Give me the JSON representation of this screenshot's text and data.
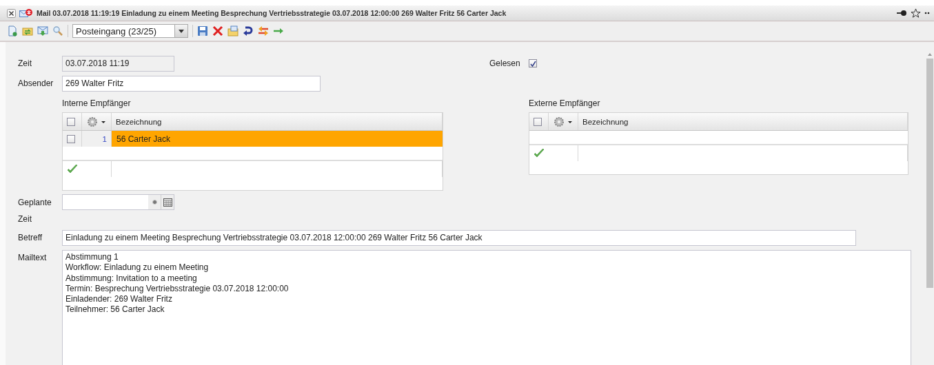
{
  "window": {
    "title": "Mail 03.07.2018 11:19:19 Einladung zu einem Meeting Besprechung Vertriebsstrategie 03.07.2018 12:00:00 269 Walter Fritz 56 Carter Jack"
  },
  "toolbar": {
    "folder_select": {
      "value": "Posteingang (23/25)"
    }
  },
  "form": {
    "time": {
      "label": "Zeit",
      "value": "03.07.2018 11:19"
    },
    "read": {
      "label": "Gelesen",
      "checked": true
    },
    "sender": {
      "label": "Absender",
      "value": "269 Walter Fritz"
    },
    "internal_recipients": {
      "label": "Interne Empfänger",
      "header_checked": false,
      "columns": [
        "Bezeichnung"
      ],
      "rows": [
        {
          "number": "1",
          "name": "56 Carter Jack",
          "checked": false,
          "selected": true
        }
      ]
    },
    "external_recipients": {
      "label": "Externe Empfänger",
      "header_checked": false,
      "columns": [
        "Bezeichnung"
      ]
    },
    "scheduled_time": {
      "label": "Geplante Zeit"
    },
    "subject": {
      "label": "Betreff",
      "value": "Einladung zu einem Meeting Besprechung Vertriebsstrategie 03.07.2018 12:00:00 269 Walter Fritz 56 Carter Jack"
    },
    "mail_text": {
      "label": "Mailtext",
      "lines": [
        "Abstimmung 1",
        "Workflow: Einladung zu einem Meeting",
        "Abstimmung: Invitation to a meeting",
        "Termin: Besprechung Vertriebsstrategie 03.07.2018 12:00:00",
        "Einladender: 269 Walter Fritz",
        "Teilnehmer: 56 Carter Jack"
      ]
    }
  }
}
